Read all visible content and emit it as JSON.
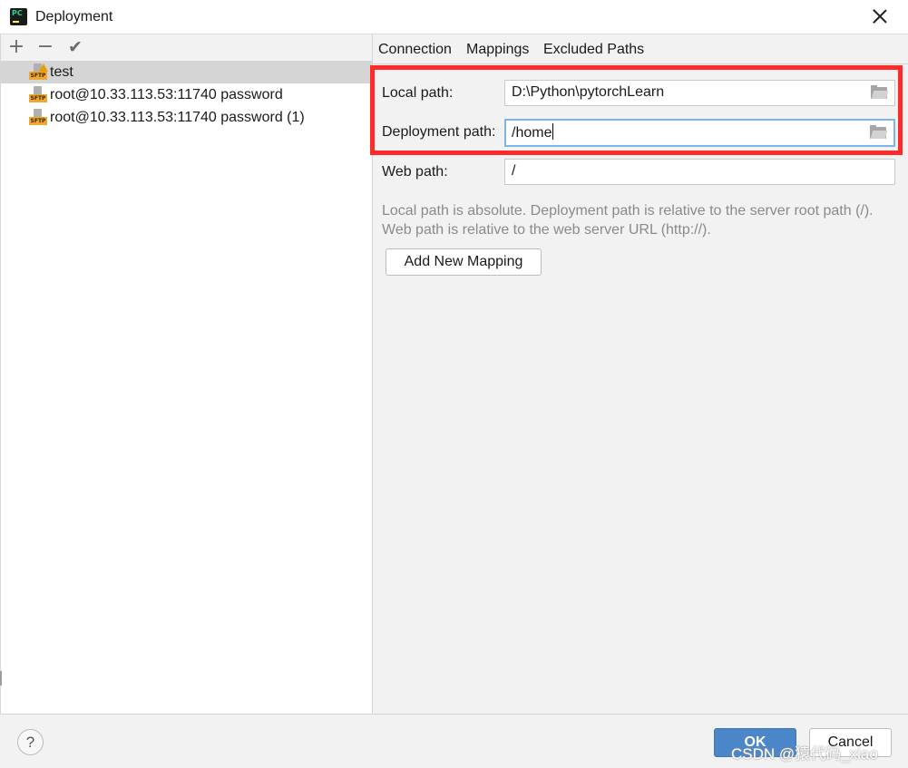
{
  "window": {
    "title": "Deployment",
    "app_icon_text": "PC"
  },
  "toolbar": {
    "add": "+",
    "remove": "−",
    "apply": "✔"
  },
  "servers": [
    {
      "name": "test",
      "icon_label": "SFTP",
      "selected": true,
      "warning": true
    },
    {
      "name": "root@10.33.113.53:11740 password",
      "icon_label": "SFTP",
      "selected": false,
      "warning": false
    },
    {
      "name": "root@10.33.113.53:11740 password (1)",
      "icon_label": "SFTP",
      "selected": false,
      "warning": false
    }
  ],
  "tabs": [
    {
      "label": "Connection"
    },
    {
      "label": "Mappings"
    },
    {
      "label": "Excluded Paths"
    }
  ],
  "form": {
    "local_path": {
      "label": "Local path:",
      "value": "D:\\Python\\pytorchLearn"
    },
    "deployment_path": {
      "label": "Deployment path:",
      "value": "/home"
    },
    "web_path": {
      "label": "Web path:",
      "value": "/"
    }
  },
  "hint": {
    "line1": "Local path is absolute. Deployment path is relative to the server root path (/).",
    "line2": "Web path is relative to the web server URL (http://)."
  },
  "add_mapping_label": "Add New Mapping",
  "footer": {
    "help": "?",
    "ok": "OK",
    "cancel": "Cancel"
  },
  "watermark": "CSDN @猿代码_xiao",
  "colors": {
    "highlight": "#ff2a2a",
    "ok_button": "#4a86c8",
    "selection": "#d5d5d5"
  }
}
